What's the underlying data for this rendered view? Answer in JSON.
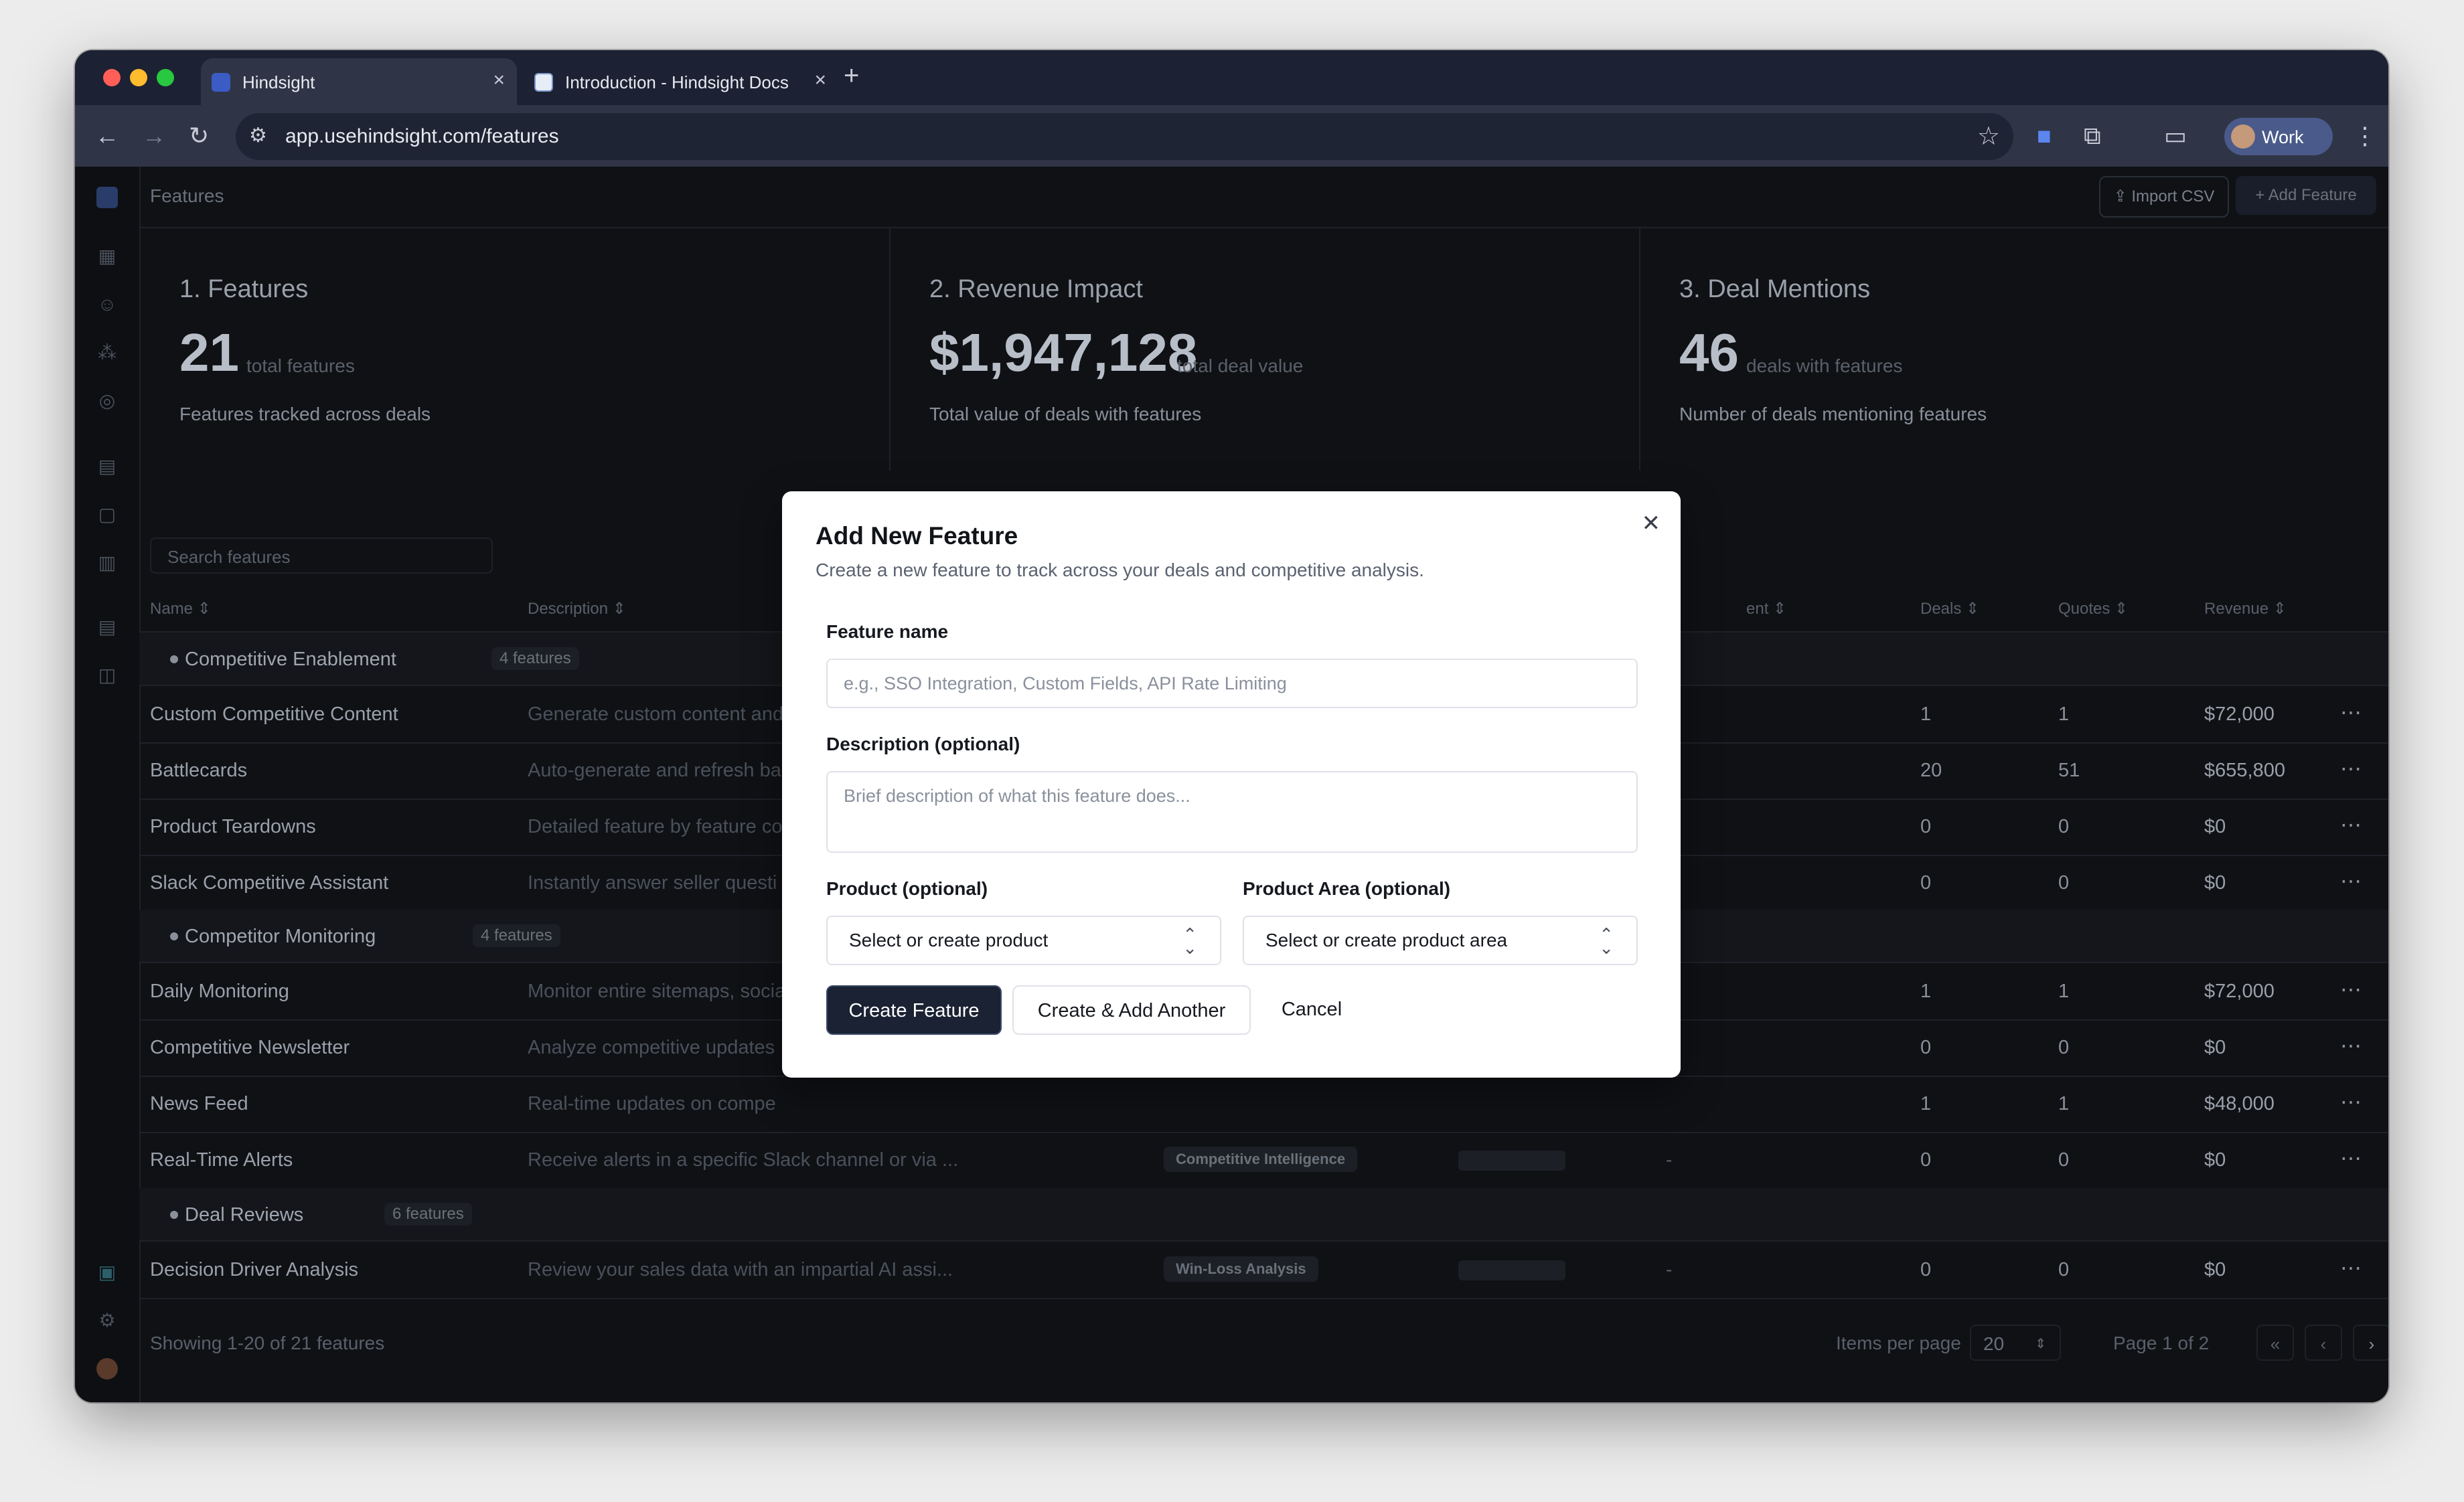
{
  "browser": {
    "tabs": [
      {
        "title": "Hindsight",
        "active": true
      },
      {
        "title": "Introduction - Hindsight Docs",
        "active": false
      }
    ],
    "url": "app.usehindsight.com/features",
    "profile": "Work"
  },
  "app": {
    "breadcrumb": "Features",
    "import_label": "Import CSV",
    "add_label": "Add Feature",
    "search_placeholder": "Search features",
    "cards": [
      {
        "heading": "1. Features",
        "value": "21",
        "unit": "total features",
        "sub": "Features tracked across deals"
      },
      {
        "heading": "2. Revenue Impact",
        "value": "$1,947,128",
        "unit": "total deal value",
        "sub": "Total value of deals with features"
      },
      {
        "heading": "3. Deal Mentions",
        "value": "46",
        "unit": "deals with features",
        "sub": "Number of deals mentioning features"
      }
    ],
    "columns": {
      "name": "Name",
      "description": "Description",
      "sentiment": "ent",
      "deals": "Deals",
      "quotes": "Quotes",
      "revenue": "Revenue"
    },
    "groups": [
      {
        "label": "Competitive Enablement",
        "count": "4 features"
      },
      {
        "label": "Competitor Monitoring",
        "count": "4 features"
      },
      {
        "label": "Deal Reviews",
        "count": "6 features"
      }
    ],
    "rows": [
      {
        "name": "Custom Competitive Content",
        "desc": "Generate custom content and",
        "area": "",
        "deals": "1",
        "quotes": "1",
        "revenue": "$72,000"
      },
      {
        "name": "Battlecards",
        "desc": "Auto-generate and refresh ba",
        "area": "",
        "deals": "20",
        "quotes": "51",
        "revenue": "$655,800"
      },
      {
        "name": "Product Teardowns",
        "desc": "Detailed feature by feature co",
        "area": "",
        "deals": "0",
        "quotes": "0",
        "revenue": "$0"
      },
      {
        "name": "Slack Competitive Assistant",
        "desc": "Instantly answer seller questi",
        "area": "",
        "deals": "0",
        "quotes": "0",
        "revenue": "$0"
      },
      {
        "name": "Daily Monitoring",
        "desc": "Monitor entire sitemaps, socia",
        "area": "",
        "deals": "1",
        "quotes": "1",
        "revenue": "$72,000"
      },
      {
        "name": "Competitive Newsletter",
        "desc": "Analyze competitive updates",
        "area": "",
        "deals": "0",
        "quotes": "0",
        "revenue": "$0"
      },
      {
        "name": "News Feed",
        "desc": "Real-time updates on compe",
        "area": "",
        "deals": "1",
        "quotes": "1",
        "revenue": "$48,000"
      },
      {
        "name": "Real-Time Alerts",
        "desc": "Receive alerts in a specific Slack channel or via ...",
        "area": "Competitive Intelligence",
        "dash": "-",
        "deals": "0",
        "quotes": "0",
        "revenue": "$0"
      },
      {
        "name": "Decision Driver Analysis",
        "desc": "Review your sales data with an impartial AI assi...",
        "area": "Win-Loss Analysis",
        "dash": "-",
        "deals": "0",
        "quotes": "0",
        "revenue": "$0"
      }
    ],
    "footer": {
      "showing": "Showing 1-20 of 21 features",
      "items_per_page_label": "Items per page",
      "items_per_page": "20",
      "page": "Page 1 of 2"
    }
  },
  "modal": {
    "title": "Add New Feature",
    "description": "Create a new feature to track across your deals and competitive analysis.",
    "name_label": "Feature name",
    "name_placeholder": "e.g., SSO Integration, Custom Fields, API Rate Limiting",
    "desc_label": "Description (optional)",
    "desc_placeholder": "Brief description of what this feature does...",
    "product_label": "Product (optional)",
    "product_value": "Select or create product",
    "area_label": "Product Area (optional)",
    "area_value": "Select or create product area",
    "create_label": "Create Feature",
    "create_another_label": "Create & Add Another",
    "cancel_label": "Cancel"
  }
}
